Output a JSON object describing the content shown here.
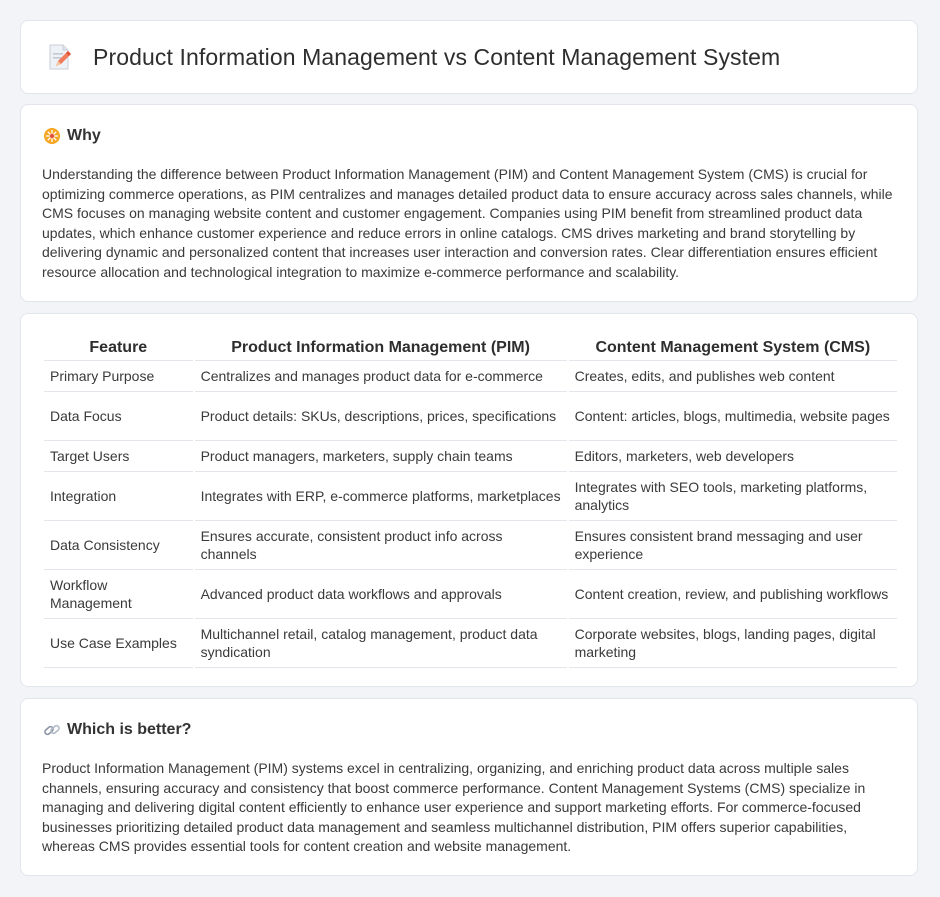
{
  "header": {
    "title": "Product Information Management vs Content Management System",
    "icon": "document-pencil-icon"
  },
  "why": {
    "title": "Why",
    "icon": "fireworks-icon",
    "text": "Understanding the difference between Product Information Management (PIM) and Content Management System (CMS) is crucial for optimizing commerce operations, as PIM centralizes and manages detailed product data to ensure accuracy across sales channels, while CMS focuses on managing website content and customer engagement. Companies using PIM benefit from streamlined product data updates, which enhance customer experience and reduce errors in online catalogs. CMS drives marketing and brand storytelling by delivering dynamic and personalized content that increases user interaction and conversion rates. Clear differentiation ensures efficient resource allocation and technological integration to maximize e-commerce performance and scalability."
  },
  "table": {
    "headers": [
      "Feature",
      "Product Information Management (PIM)",
      "Content Management System (CMS)"
    ],
    "rows": [
      [
        "Primary Purpose",
        "Centralizes and manages product data for e-commerce",
        "Creates, edits, and publishes web content"
      ],
      [
        "Data Focus",
        "Product details: SKUs, descriptions, prices, specifications",
        "Content: articles, blogs, multimedia, website pages"
      ],
      [
        "Target Users",
        "Product managers, marketers, supply chain teams",
        "Editors, marketers, web developers"
      ],
      [
        "Integration",
        "Integrates with ERP, e-commerce platforms, marketplaces",
        "Integrates with SEO tools, marketing platforms, analytics"
      ],
      [
        "Data Consistency",
        "Ensures accurate, consistent product info across channels",
        "Ensures consistent brand messaging and user experience"
      ],
      [
        "Workflow Management",
        "Advanced product data workflows and approvals",
        "Content creation, review, and publishing workflows"
      ],
      [
        "Use Case Examples",
        "Multichannel retail, catalog management, product data syndication",
        "Corporate websites, blogs, landing pages, digital marketing"
      ]
    ]
  },
  "better": {
    "title": "Which is better?",
    "icon": "link-icon",
    "text": "Product Information Management (PIM) systems excel in centralizing, organizing, and enriching product data across multiple sales channels, ensuring accuracy and consistency that boost commerce performance. Content Management Systems (CMS) specialize in managing and delivering digital content efficiently to enhance user experience and support marketing efforts. For commerce-focused businesses prioritizing detailed product data management and seamless multichannel distribution, PIM offers superior capabilities, whereas CMS provides essential tools for content creation and website management."
  }
}
